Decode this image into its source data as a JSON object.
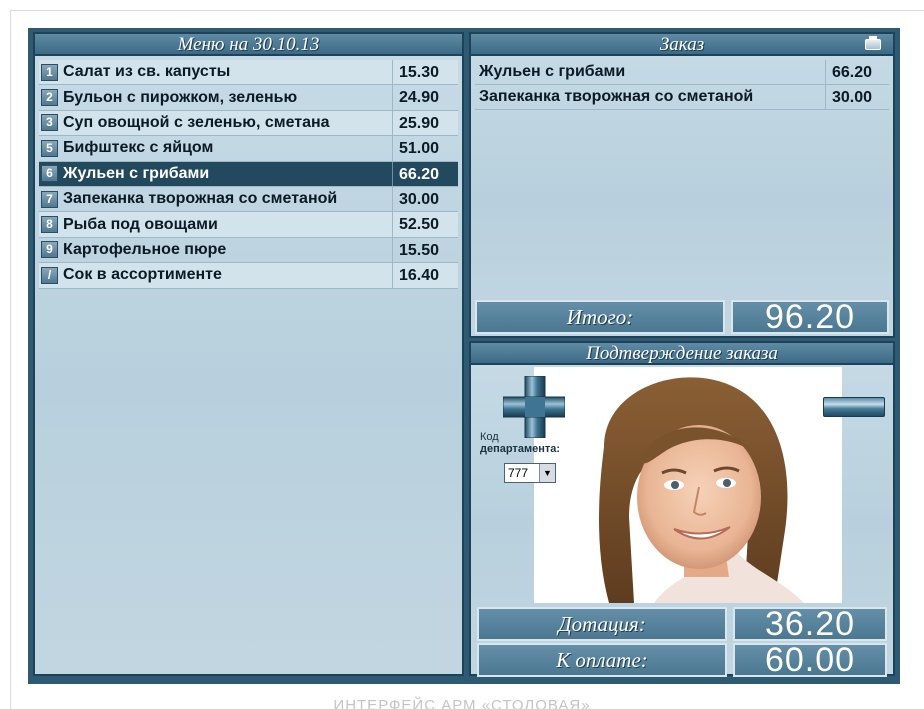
{
  "caption": "ИНТЕРФЕЙС АРМ «СТОЛОВАЯ»",
  "menu": {
    "title": "Меню на 30.10.13",
    "items": [
      {
        "num": "1",
        "name": "Салат из св. капусты",
        "price": "15.30"
      },
      {
        "num": "2",
        "name": "Бульон с пирожком, зеленью",
        "price": "24.90"
      },
      {
        "num": "3",
        "name": "Суп овощной с зеленью, сметана",
        "price": "25.90"
      },
      {
        "num": "5",
        "name": "Бифштекс с яйцом",
        "price": "51.00"
      },
      {
        "num": "6",
        "name": "Жульен с грибами",
        "price": "66.20"
      },
      {
        "num": "7",
        "name": "Запеканка творожная со сметаной",
        "price": "30.00"
      },
      {
        "num": "8",
        "name": "Рыба под овощами",
        "price": "52.50"
      },
      {
        "num": "9",
        "name": "Картофельное пюре",
        "price": "15.50"
      },
      {
        "num": "/",
        "name": "Сок в ассортименте",
        "price": "16.40"
      }
    ],
    "selected_index": 4
  },
  "order": {
    "title": "Заказ",
    "items": [
      {
        "name": "Жульен с грибами",
        "price": "66.20"
      },
      {
        "name": "Запеканка творожная со сметаной",
        "price": "30.00"
      }
    ],
    "total_label": "Итого:",
    "total_value": "96.20"
  },
  "confirm": {
    "title": "Подтверждение заказа",
    "dept_label_line1": "Код",
    "dept_label_line2": "департамента:",
    "dept_value": "777",
    "subsidy_label": "Дотация:",
    "subsidy_value": "36.20",
    "to_pay_label": "К оплате:",
    "to_pay_value": "60.00"
  },
  "icons": {
    "print": "printer-icon",
    "plus": "plus-icon",
    "minus": "minus-icon",
    "dropdown": "chevron-down-icon"
  },
  "colors": {
    "accent": "#2f5a73",
    "selected_row": "#23495f",
    "panel_bg": "#bdd3df"
  }
}
